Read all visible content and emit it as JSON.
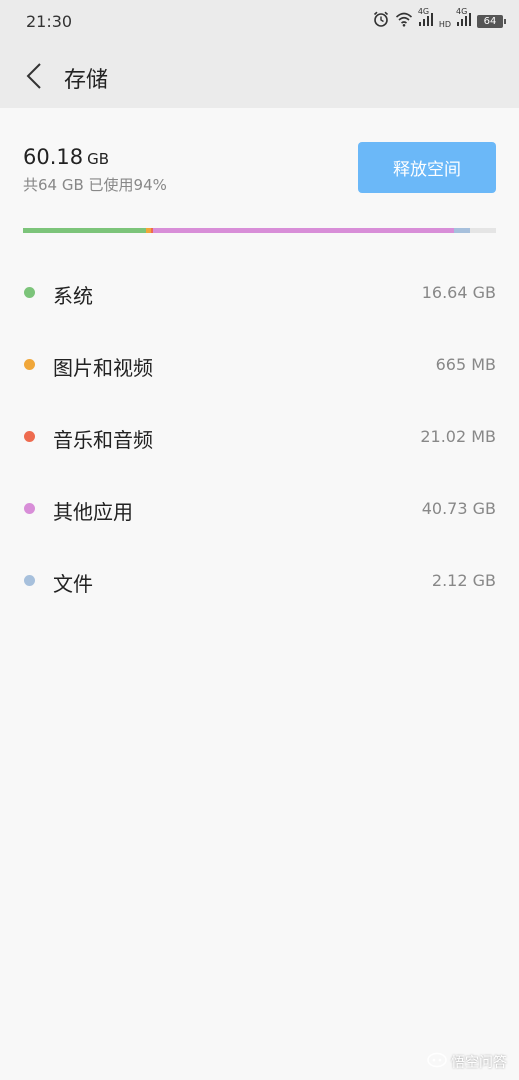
{
  "status_bar": {
    "time": "21:30",
    "network_1": "4G",
    "network_hd": "HD",
    "network_2": "4G",
    "battery": "64",
    "icons": [
      "alarm-icon",
      "wifi-icon",
      "signal-icon",
      "signal-icon",
      "battery-icon"
    ]
  },
  "header": {
    "title": "存储",
    "back_icon": "chevron-left-icon"
  },
  "summary": {
    "used_value": "60.18",
    "used_unit": "GB",
    "total_text": "共64 GB 已使用94%",
    "release_button_label": "释放空间",
    "accent_color": "#6bb8f8"
  },
  "storage_bar": {
    "segments": [
      {
        "name": "系统",
        "fraction": 0.26,
        "color": "#7cc47a"
      },
      {
        "name": "图片和视频",
        "fraction": 0.0104,
        "color": "#f0a73a"
      },
      {
        "name": "音乐和音频",
        "fraction": 0.0048,
        "color": "#ee6b4f"
      },
      {
        "name": "其他应用",
        "fraction": 0.6364,
        "color": "#d88ed8"
      },
      {
        "name": "文件",
        "fraction": 0.0331,
        "color": "#a7c0dc"
      }
    ],
    "track_color": "#e5e5e5"
  },
  "categories": [
    {
      "name": "系统",
      "size": "16.64 GB",
      "color": "#7cc47a"
    },
    {
      "name": "图片和视频",
      "size": "665 MB",
      "color": "#f0a73a"
    },
    {
      "name": "音乐和音频",
      "size": "21.02 MB",
      "color": "#ee6b4f"
    },
    {
      "name": "其他应用",
      "size": "40.73 GB",
      "color": "#d88ed8"
    },
    {
      "name": "文件",
      "size": "2.12 GB",
      "color": "#a7c0dc"
    }
  ],
  "watermark": {
    "text": "悟空问答",
    "icon": "wukong-logo-icon"
  }
}
